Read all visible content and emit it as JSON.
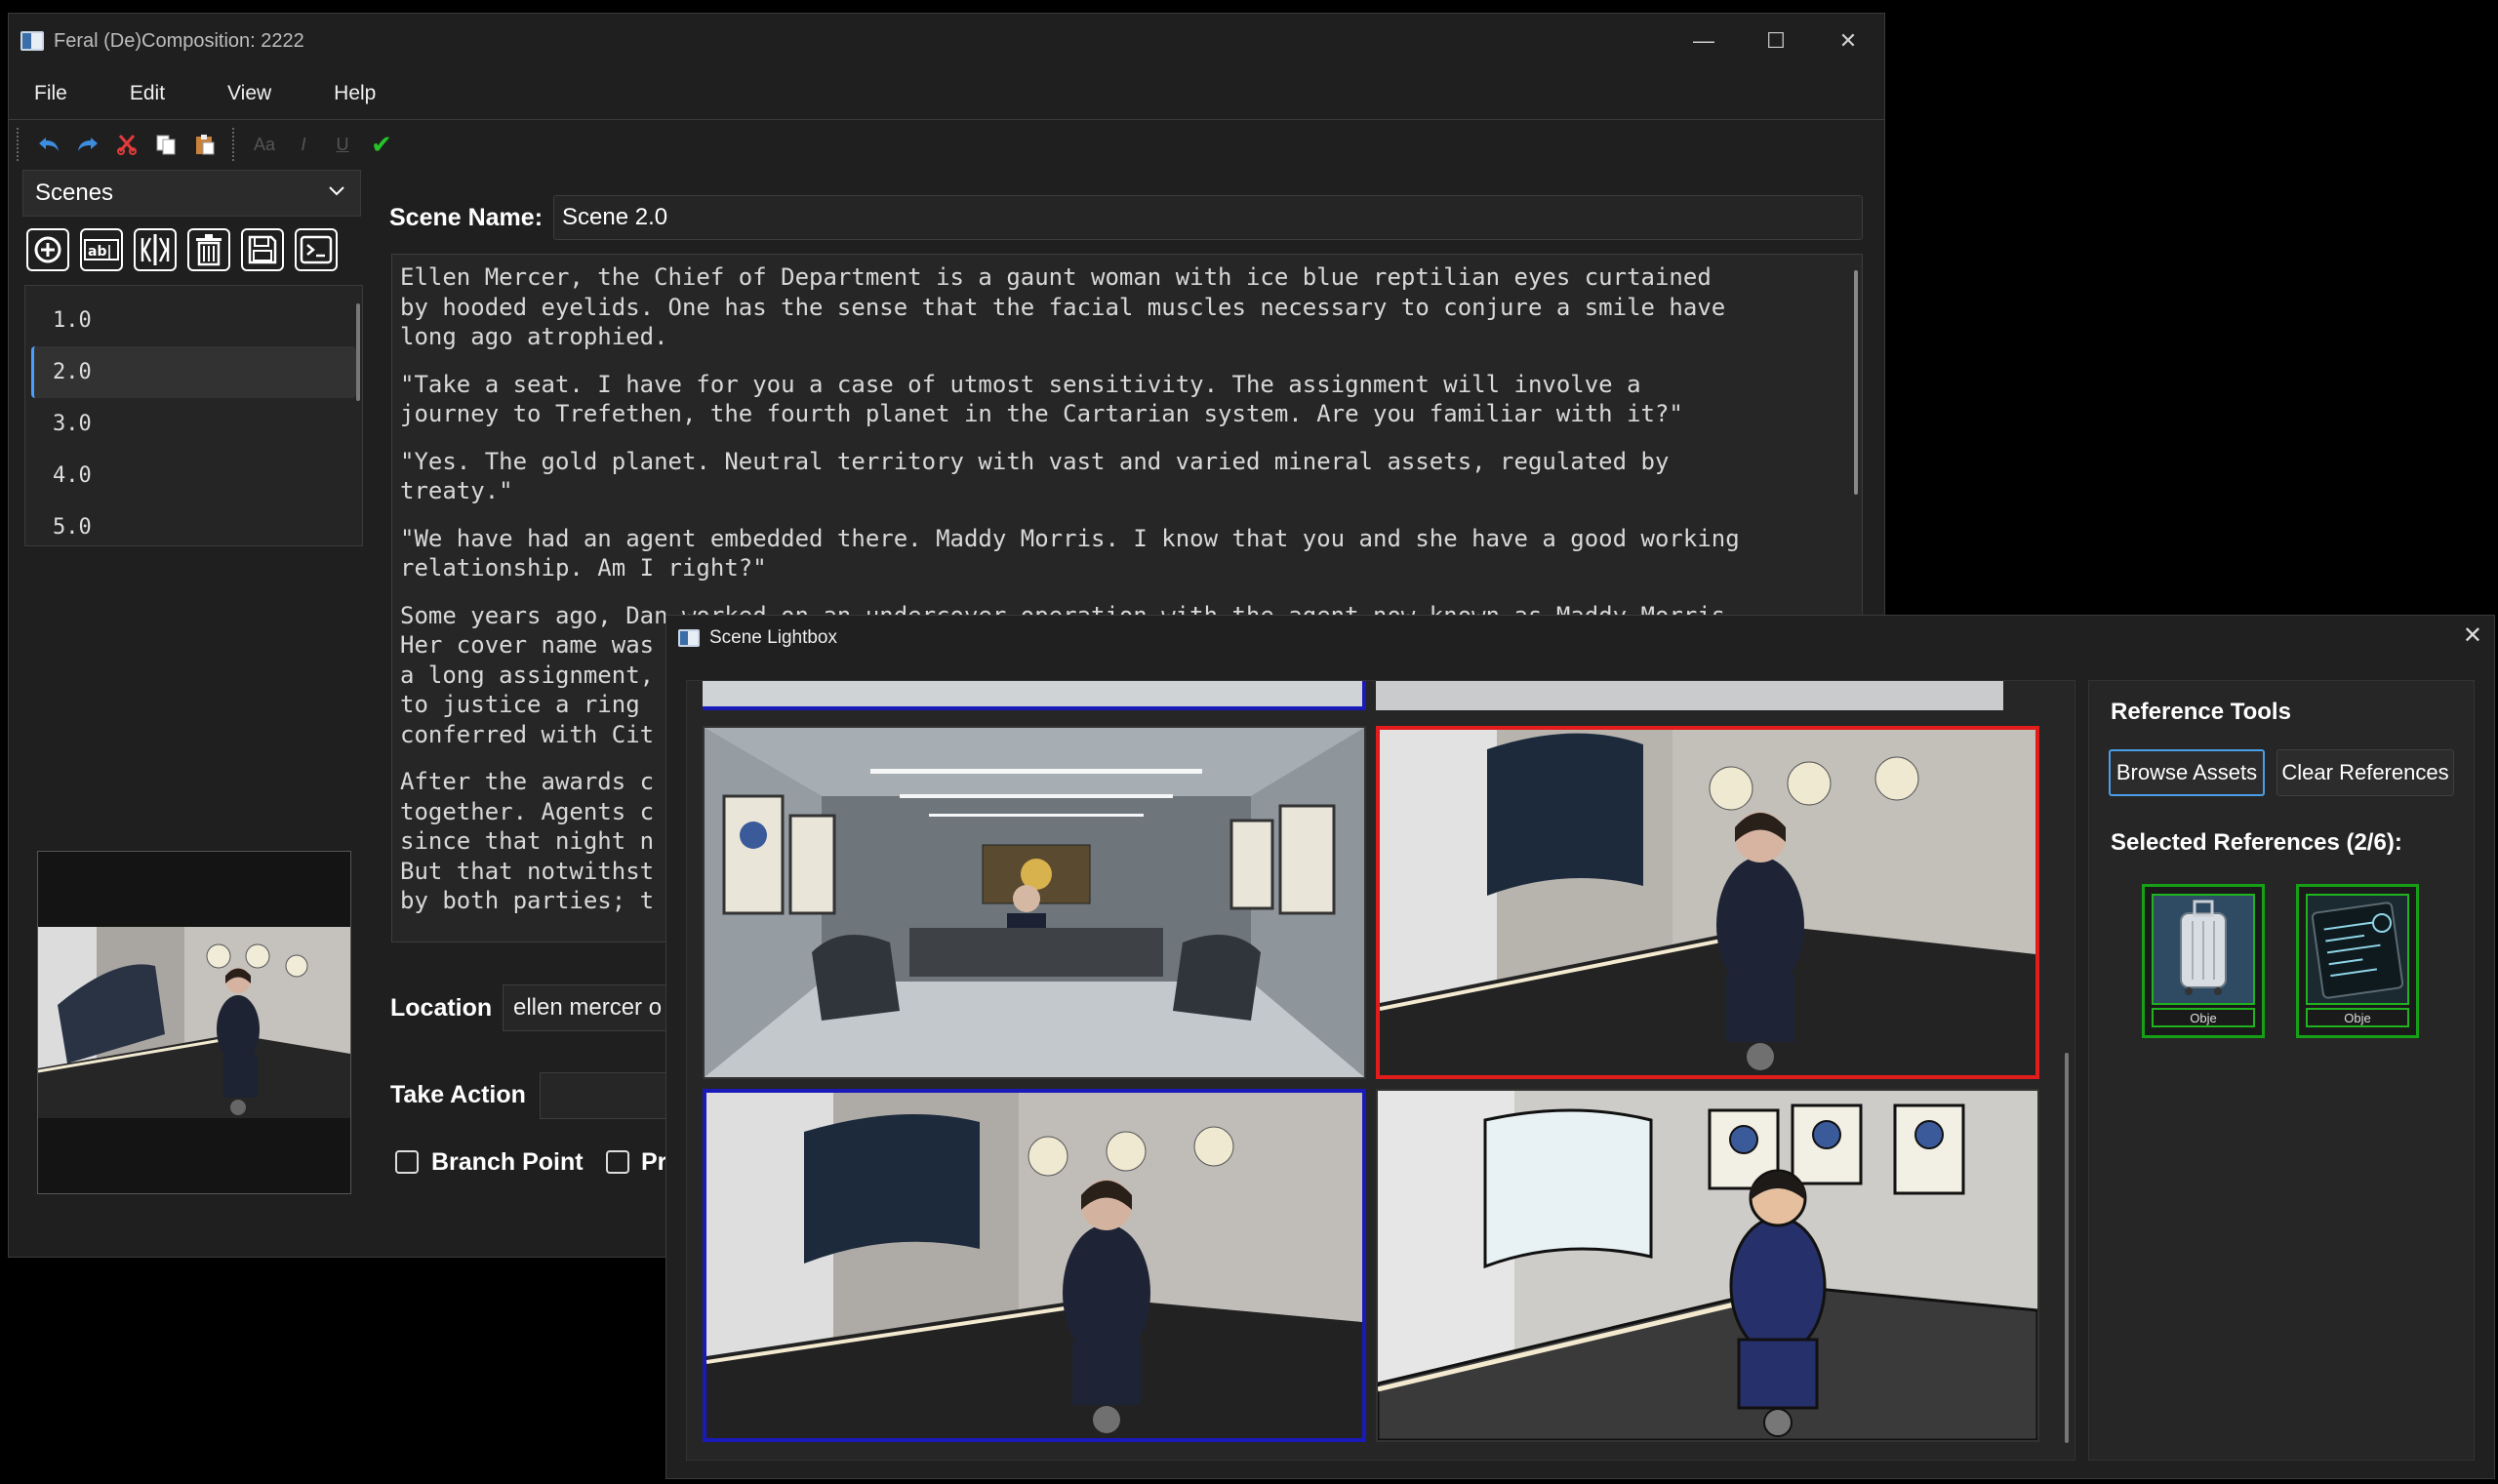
{
  "main_window": {
    "title": "Feral (De)Composition: 2222",
    "controls": {
      "minimize": "—",
      "maximize": "☐",
      "close": "✕"
    }
  },
  "menu": [
    "File",
    "Edit",
    "View",
    "Help"
  ],
  "toolbar": {
    "icons": [
      "undo-icon",
      "redo-icon",
      "cut-icon",
      "copy-icon",
      "paste-icon",
      "font-icon",
      "italic-icon",
      "underline-icon",
      "check-icon"
    ],
    "font_label": "Aa",
    "italic_label": "I",
    "underline_label": "U",
    "check_label": "✔"
  },
  "scenes": {
    "combo_label": "Scenes",
    "tools": [
      "add-scene-icon",
      "rename-icon",
      "split-icon",
      "delete-icon",
      "save-icon",
      "console-icon"
    ],
    "items": [
      "1.0",
      "2.0",
      "3.0",
      "4.0",
      "5.0"
    ],
    "selected_index": 1
  },
  "editor": {
    "scene_name_label": "Scene Name:",
    "scene_name_value": "Scene 2.0",
    "paragraphs": [
      "Ellen Mercer, the Chief of Department is a gaunt woman with ice blue reptilian eyes curtained\nby hooded eyelids. One has the sense that the facial muscles necessary to conjure a smile have\nlong ago atrophied.",
      "\"Take a seat. I have for you a case of utmost sensitivity. The assignment will involve a\njourney to Trefethen, the fourth planet in the Cartarian system. Are you familiar with it?\"",
      "\"Yes. The gold planet. Neutral territory with vast and varied mineral assets, regulated by\ntreaty.\"",
      "\"We have had an agent embedded there. Maddy Morris. I know that you and she have a good working\nrelationship. Am I right?\"",
      "Some years ago, Dan worked on an undercover operation with the agent now known as Maddy Morris.\nHer cover name was\na long assignment,\nto justice a ring\nconferred with Cit",
      "After the awards c\ntogether. Agents c\nsince that night n\nBut that notwithst\nby both parties; t"
    ],
    "location_label": "Location",
    "location_value": "ellen mercer o",
    "take_action_label": "Take Action",
    "take_action_value": "",
    "branch_point_label": "Branch Point",
    "second_check_label": "Pr"
  },
  "lightbox": {
    "title": "Scene Lightbox",
    "close": "✕",
    "reference_tools_title": "Reference Tools",
    "browse_button": "Browse Assets",
    "clear_button": "Clear References",
    "selected_label": "Selected References (2/6):",
    "references": [
      {
        "icon": "luggage-icon",
        "caption": "Obje"
      },
      {
        "icon": "tablet-icon",
        "caption": "Obje"
      }
    ]
  },
  "colors": {
    "selected_red": "#e21b1b",
    "selected_blue": "#1a1ab8",
    "reference_green": "#16a016",
    "accent_blue": "#4a9ee8"
  }
}
